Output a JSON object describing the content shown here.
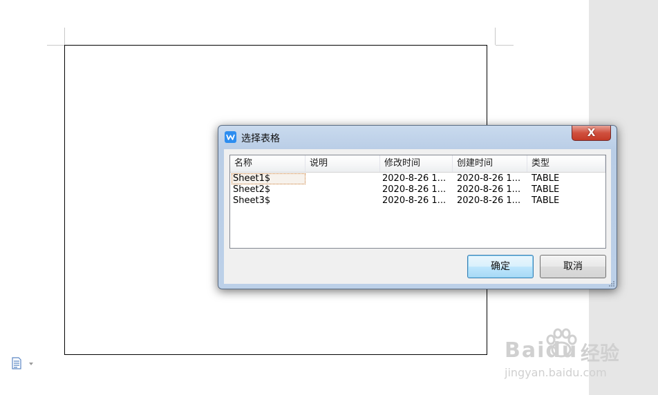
{
  "dialog": {
    "title": "选择表格",
    "close_symbol": "X",
    "columns": [
      "名称",
      "说明",
      "修改时间",
      "创建时间",
      "类型"
    ],
    "rows": [
      {
        "name": "Sheet1$",
        "desc": "",
        "modified": "2020-8-26 1...",
        "created": "2020-8-26 1...",
        "type": "TABLE"
      },
      {
        "name": "Sheet2$",
        "desc": "",
        "modified": "2020-8-26 1...",
        "created": "2020-8-26 1...",
        "type": "TABLE"
      },
      {
        "name": "Sheet3$",
        "desc": "",
        "modified": "2020-8-26 1...",
        "created": "2020-8-26 1...",
        "type": "TABLE"
      }
    ],
    "selected_row": 0,
    "ok_label": "确定",
    "cancel_label": "取消"
  },
  "watermark": {
    "brand": "Baidu",
    "brand_cn": "经验",
    "url": "jingyan.baidu.com"
  },
  "colors": {
    "accent": "#2c8df0",
    "close_red": "#c43a27"
  }
}
